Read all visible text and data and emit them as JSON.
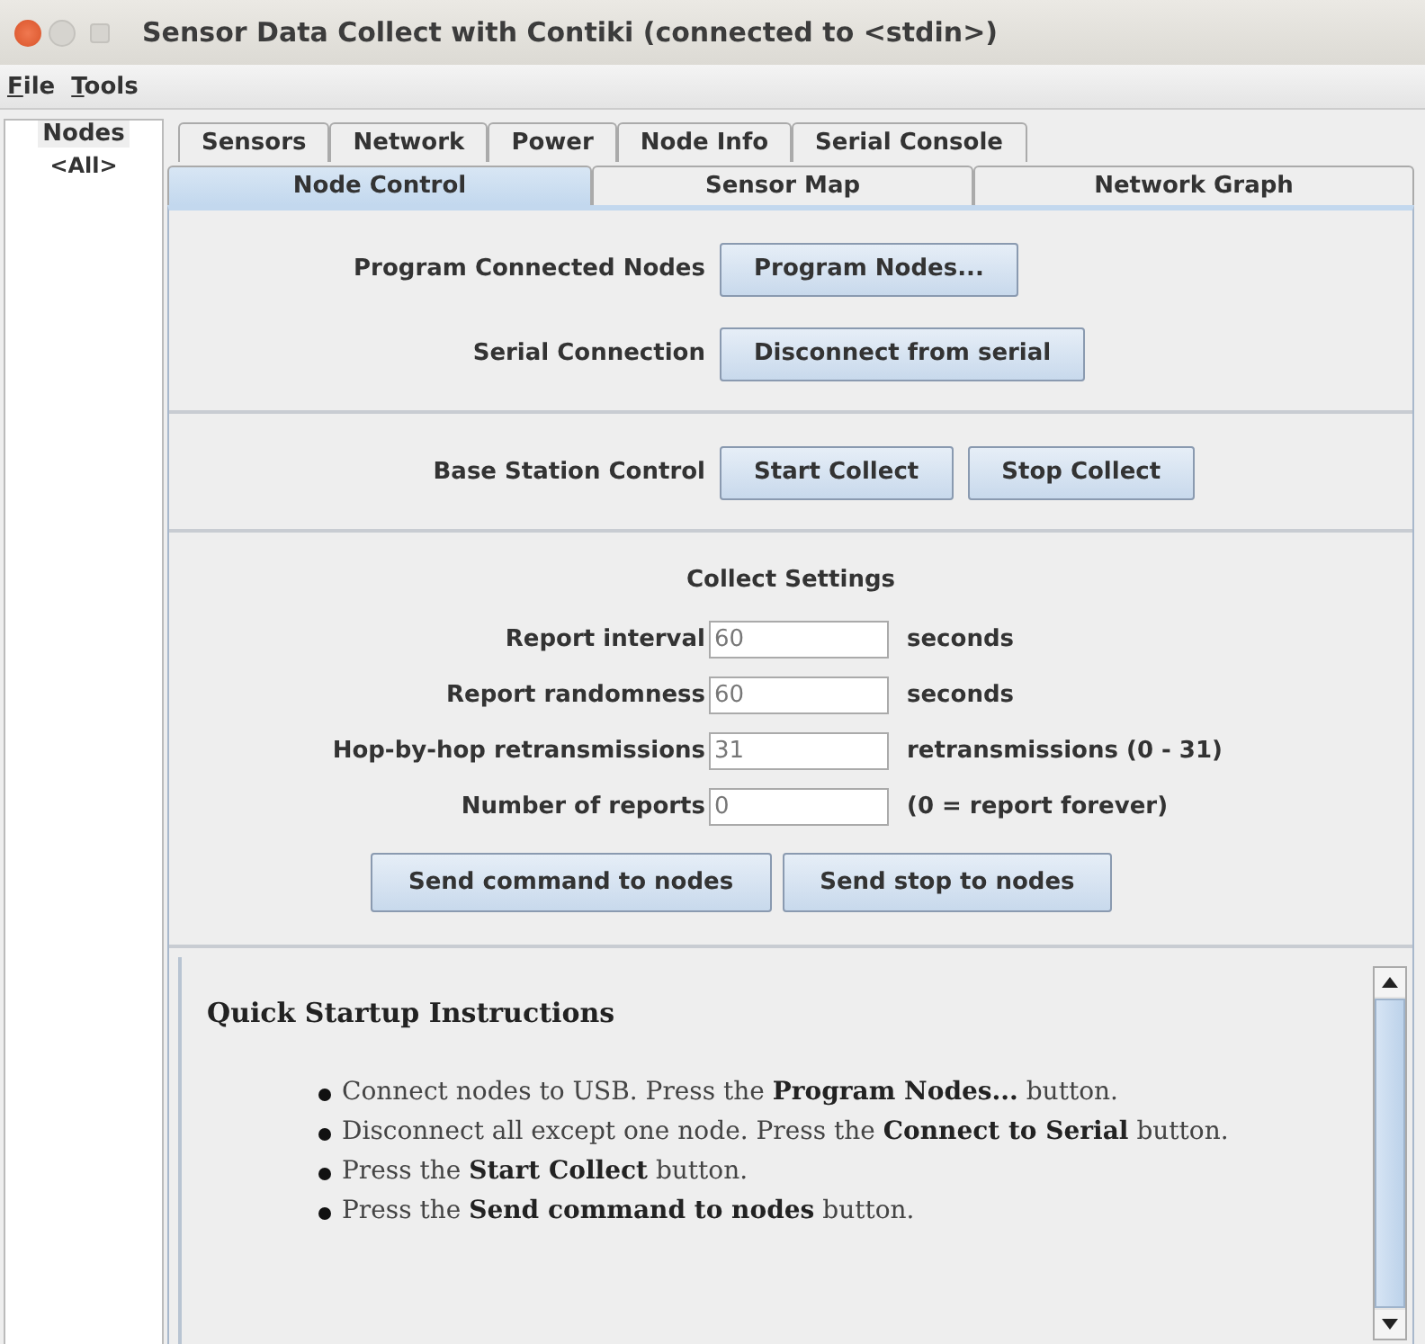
{
  "window": {
    "title": "Sensor Data Collect with Contiki (connected to <stdin>)"
  },
  "menu": [
    {
      "label": "File"
    },
    {
      "label": "Tools"
    }
  ],
  "nodes_panel": {
    "header": "Nodes",
    "items": [
      "<All>"
    ]
  },
  "tabs_row_1": [
    {
      "label": "Sensors",
      "selected": false
    },
    {
      "label": "Network",
      "selected": false
    },
    {
      "label": "Power",
      "selected": false
    },
    {
      "label": "Node Info",
      "selected": false
    },
    {
      "label": "Serial Console",
      "selected": false
    }
  ],
  "tabs_row_2": [
    {
      "label": "Node Control",
      "selected": true
    },
    {
      "label": "Sensor Map",
      "selected": false
    },
    {
      "label": "Network Graph",
      "selected": false
    }
  ],
  "node_control": {
    "sections": [
      {
        "kind": "rows",
        "rows": [
          {
            "label": "Program Connected Nodes",
            "buttons": [
              "Program Nodes..."
            ]
          },
          {
            "label": "Serial Connection",
            "buttons": [
              "Disconnect from serial"
            ]
          }
        ]
      },
      {
        "kind": "rows",
        "rows": [
          {
            "label": "Base Station Control",
            "buttons": [
              "Start Collect",
              "Stop Collect"
            ]
          }
        ]
      },
      {
        "kind": "settings",
        "heading": "Collect Settings",
        "fields": [
          {
            "label": "Report interval",
            "value": "60",
            "unit": "seconds"
          },
          {
            "label": "Report randomness",
            "value": "60",
            "unit": "seconds"
          },
          {
            "label": "Hop-by-hop retransmissions",
            "value": "31",
            "unit": "retransmissions (0 - 31)"
          },
          {
            "label": "Number of reports",
            "value": "0",
            "unit": "(0 = report forever)"
          }
        ],
        "buttons": [
          "Send command to nodes",
          "Send stop to nodes"
        ]
      }
    ]
  },
  "instructions": {
    "heading": "Quick Startup Instructions",
    "items": [
      "Connect nodes to USB. Press the **Program Nodes...** button.",
      "Disconnect all except one node. Press the **Connect to Serial** button.",
      "Press the **Start Collect** button.",
      "Press the **Send command to nodes** button."
    ]
  }
}
